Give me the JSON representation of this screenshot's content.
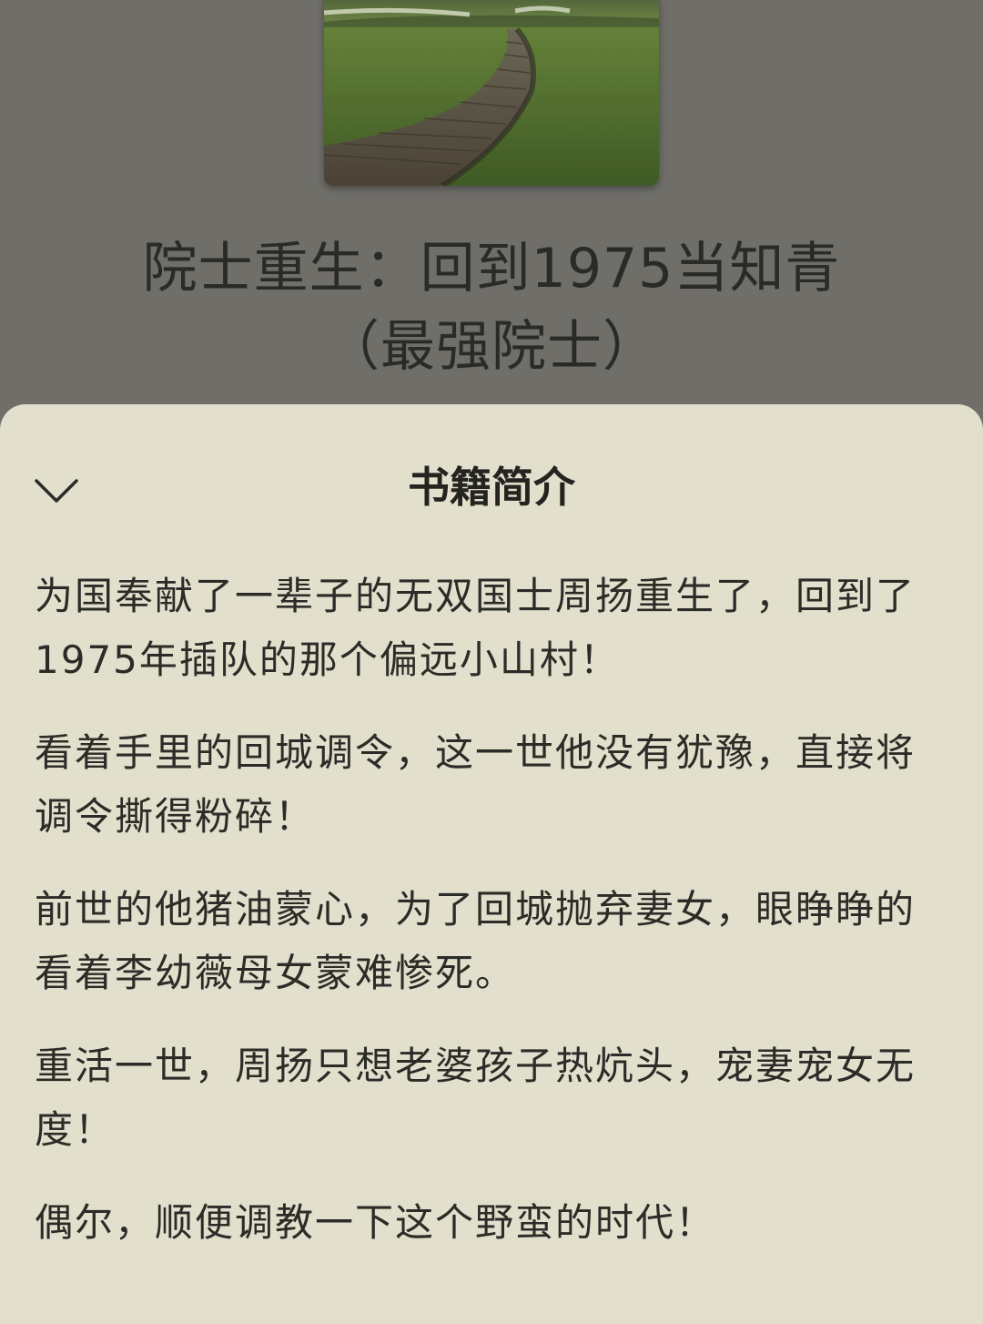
{
  "book": {
    "title_line1": "院士重生：回到1975当知青",
    "title_line2": "（最强院士）"
  },
  "sheet": {
    "title": "书籍简介",
    "collapse_icon": "chevron-down-icon",
    "paragraphs": [
      "为国奉献了一辈子的无双国士周扬重生了，回到了1975年插队的那个偏远小山村！",
      "看着手里的回城调令，这一世他没有犹豫，直接将调令撕得粉碎！",
      "前世的他猪油蒙心，为了回城抛弃妻女，眼睁睁的看着李幼薇母女蒙难惨死。",
      "重活一世，周扬只想老婆孩子热炕头，宠妻宠女无度！",
      "偶尔，顺便调教一下这个野蛮的时代！"
    ]
  },
  "colors": {
    "backdrop": "#6f6e69",
    "sheet_background": "#e2dfcc",
    "text": "#2b2b27"
  }
}
